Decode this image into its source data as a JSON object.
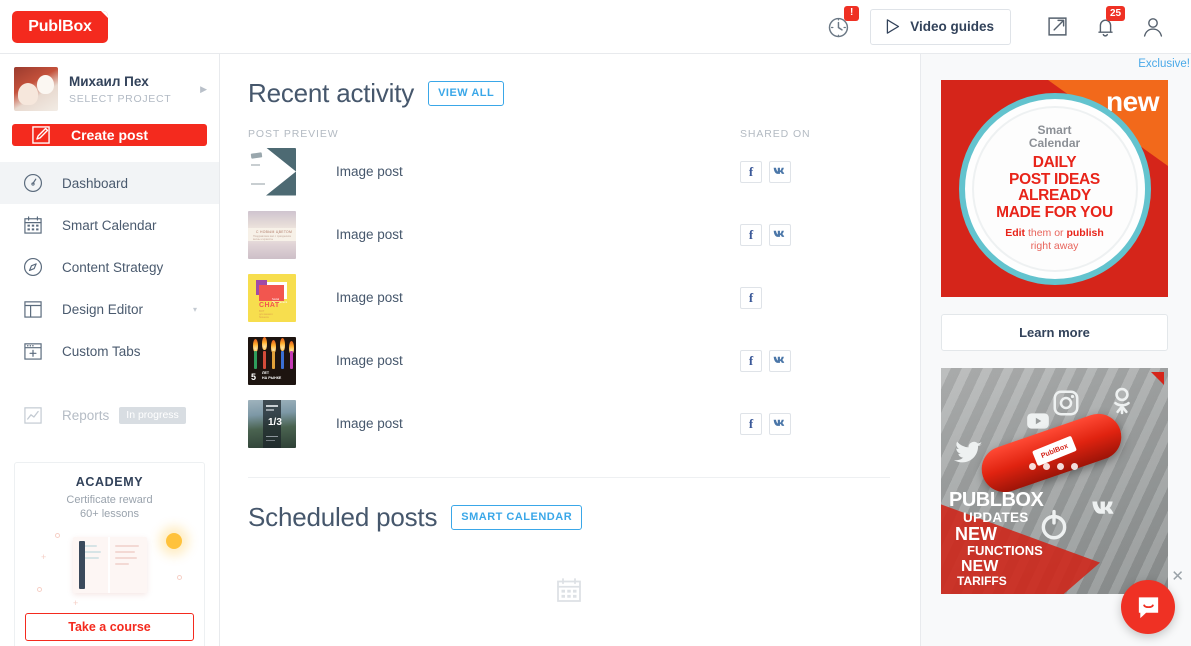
{
  "brand": {
    "logo_text": "PublBox",
    "accent": "#f42a1e",
    "blue": "#3aa7e8"
  },
  "topbar": {
    "history_badge": "!",
    "video_guides_label": "Video guides",
    "notifications_badge": "25"
  },
  "sidebar": {
    "profile": {
      "name": "Михаил Пех",
      "subtitle": "SELECT PROJECT"
    },
    "create_post_label": "Create post",
    "items": [
      {
        "label": "Dashboard",
        "icon": "gauge-icon",
        "active": true
      },
      {
        "label": "Smart Calendar",
        "icon": "calendar-icon",
        "active": false
      },
      {
        "label": "Content Strategy",
        "icon": "compass-icon",
        "active": false
      },
      {
        "label": "Design Editor",
        "icon": "layout-icon",
        "active": false,
        "chevron": "▾"
      },
      {
        "label": "Custom Tabs",
        "icon": "window-plus-icon",
        "active": false
      },
      {
        "label": "Reports",
        "icon": "chart-line-icon",
        "active": false,
        "disabled": true,
        "badge": "In progress"
      }
    ],
    "academy": {
      "title": "ACADEMY",
      "line1": "Certificate reward",
      "line2": "60+ lessons",
      "cta": "Take a course"
    }
  },
  "main": {
    "recent": {
      "title": "Recent activity",
      "action": "VIEW ALL",
      "col_preview": "POST PREVIEW",
      "col_shared": "SHARED ON",
      "rows": [
        {
          "label": "Image post",
          "thumb": "arrow-white-teal",
          "networks": [
            "facebook",
            "vk"
          ]
        },
        {
          "label": "Image post",
          "thumb": "floral-eggs",
          "networks": [
            "facebook",
            "vk"
          ]
        },
        {
          "label": "Image post",
          "thumb": "yellow-chat",
          "networks": [
            "facebook"
          ]
        },
        {
          "label": "Image post",
          "thumb": "candles-5years",
          "networks": [
            "facebook",
            "vk"
          ]
        },
        {
          "label": "Image post",
          "thumb": "coast-dark",
          "networks": [
            "facebook",
            "vk"
          ]
        }
      ]
    },
    "scheduled": {
      "title": "Scheduled posts",
      "action": "SMART CALENDAR"
    }
  },
  "rightpanel": {
    "exclusive_label": "Exclusive!",
    "promo1": {
      "ribbon": "new",
      "kicker": "Smart\nCalendar",
      "headline_l1": "DAILY",
      "headline_l2": "POST IDEAS",
      "headline_l3": "ALREADY",
      "headline_l4": "MADE FOR YOU",
      "foot_a": "Edit",
      "foot_b": " them or ",
      "foot_c": "publish",
      "foot_d": "right away"
    },
    "learn_more_label": "Learn more",
    "promo2": {
      "badge_text": "PublBox",
      "l1": "PUBLBOX",
      "l2": "UPDATES",
      "l3": "NEW",
      "l4": "FUNCTIONS",
      "l5": "NEW",
      "l6": "TARIFFS"
    }
  },
  "intercom": {
    "close": "✕"
  }
}
